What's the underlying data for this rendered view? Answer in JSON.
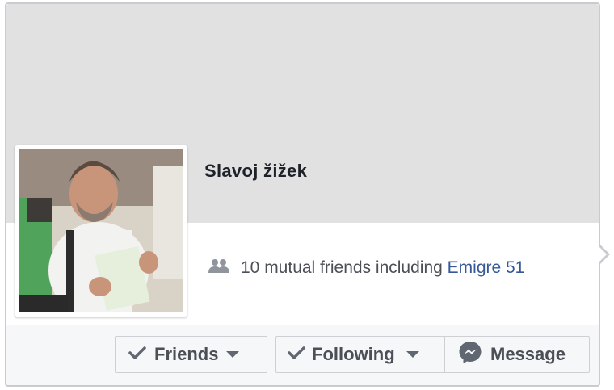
{
  "profile": {
    "name": "Slavoj žižek",
    "mutual_text": "10 mutual friends including ",
    "mutual_link": "Emigre 51"
  },
  "actions": {
    "friends_label": "Friends",
    "following_label": "Following",
    "message_label": "Message"
  },
  "icons": {
    "mutual": "friends-icon",
    "friends": "check-icon",
    "following": "check-icon",
    "message": "messenger-icon"
  },
  "colors": {
    "cover": "#e1e1e1",
    "link": "#365899",
    "text": "#4b4f56"
  }
}
